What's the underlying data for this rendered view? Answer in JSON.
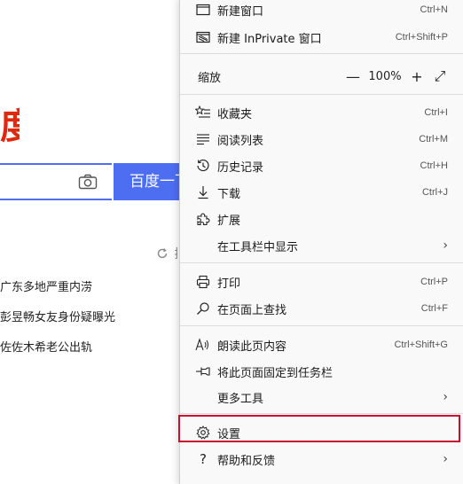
{
  "page": {
    "logo_char": "度",
    "search_button": "百度一下",
    "refresh_label": "换",
    "news": [
      "广东多地严重内涝",
      "彭昱畅女友身份疑曝光",
      "佐佐木希老公出轨"
    ]
  },
  "menu": {
    "new_window": {
      "label": "新建窗口",
      "shortcut": "Ctrl+N"
    },
    "new_inprivate": {
      "label": "新建 InPrivate 窗口",
      "shortcut": "Ctrl+Shift+P"
    },
    "zoom": {
      "label": "缩放",
      "minus": "—",
      "value": "100%",
      "plus": "+",
      "expand": "⤢"
    },
    "favorites": {
      "label": "收藏夹",
      "shortcut": "Ctrl+I"
    },
    "reading_list": {
      "label": "阅读列表",
      "shortcut": "Ctrl+M"
    },
    "history": {
      "label": "历史记录",
      "shortcut": "Ctrl+H"
    },
    "downloads": {
      "label": "下载",
      "shortcut": "Ctrl+J"
    },
    "extensions": {
      "label": "扩展"
    },
    "show_in_toolbar": {
      "label": "在工具栏中显示",
      "chevron": "›"
    },
    "print": {
      "label": "打印",
      "shortcut": "Ctrl+P"
    },
    "find": {
      "label": "在页面上查找",
      "shortcut": "Ctrl+F"
    },
    "read_aloud": {
      "label": "朗读此页内容",
      "shortcut": "Ctrl+Shift+G"
    },
    "pin_taskbar": {
      "label": "将此页面固定到任务栏"
    },
    "more_tools": {
      "label": "更多工具",
      "chevron": "›"
    },
    "settings": {
      "label": "设置"
    },
    "help": {
      "label": "帮助和反馈",
      "chevron": "›"
    }
  },
  "colors": {
    "highlight": "#c8102e",
    "brand_blue": "#4e6ef2",
    "brand_red": "#de2910"
  }
}
